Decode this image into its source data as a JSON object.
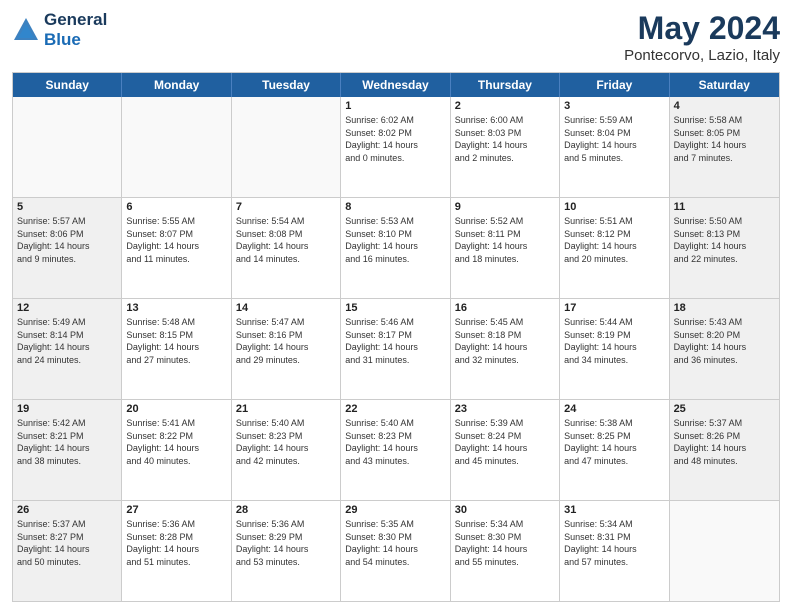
{
  "header": {
    "logo_line1": "General",
    "logo_line2": "Blue",
    "title": "May 2024",
    "subtitle": "Pontecorvo, Lazio, Italy"
  },
  "days": [
    "Sunday",
    "Monday",
    "Tuesday",
    "Wednesday",
    "Thursday",
    "Friday",
    "Saturday"
  ],
  "weeks": [
    [
      {
        "day": "",
        "empty": true
      },
      {
        "day": "",
        "empty": true
      },
      {
        "day": "",
        "empty": true
      },
      {
        "day": "1",
        "lines": [
          "Sunrise: 6:02 AM",
          "Sunset: 8:02 PM",
          "Daylight: 14 hours",
          "and 0 minutes."
        ]
      },
      {
        "day": "2",
        "lines": [
          "Sunrise: 6:00 AM",
          "Sunset: 8:03 PM",
          "Daylight: 14 hours",
          "and 2 minutes."
        ]
      },
      {
        "day": "3",
        "lines": [
          "Sunrise: 5:59 AM",
          "Sunset: 8:04 PM",
          "Daylight: 14 hours",
          "and 5 minutes."
        ]
      },
      {
        "day": "4",
        "lines": [
          "Sunrise: 5:58 AM",
          "Sunset: 8:05 PM",
          "Daylight: 14 hours",
          "and 7 minutes."
        ]
      }
    ],
    [
      {
        "day": "5",
        "lines": [
          "Sunrise: 5:57 AM",
          "Sunset: 8:06 PM",
          "Daylight: 14 hours",
          "and 9 minutes."
        ]
      },
      {
        "day": "6",
        "lines": [
          "Sunrise: 5:55 AM",
          "Sunset: 8:07 PM",
          "Daylight: 14 hours",
          "and 11 minutes."
        ]
      },
      {
        "day": "7",
        "lines": [
          "Sunrise: 5:54 AM",
          "Sunset: 8:08 PM",
          "Daylight: 14 hours",
          "and 14 minutes."
        ]
      },
      {
        "day": "8",
        "lines": [
          "Sunrise: 5:53 AM",
          "Sunset: 8:10 PM",
          "Daylight: 14 hours",
          "and 16 minutes."
        ]
      },
      {
        "day": "9",
        "lines": [
          "Sunrise: 5:52 AM",
          "Sunset: 8:11 PM",
          "Daylight: 14 hours",
          "and 18 minutes."
        ]
      },
      {
        "day": "10",
        "lines": [
          "Sunrise: 5:51 AM",
          "Sunset: 8:12 PM",
          "Daylight: 14 hours",
          "and 20 minutes."
        ]
      },
      {
        "day": "11",
        "lines": [
          "Sunrise: 5:50 AM",
          "Sunset: 8:13 PM",
          "Daylight: 14 hours",
          "and 22 minutes."
        ]
      }
    ],
    [
      {
        "day": "12",
        "lines": [
          "Sunrise: 5:49 AM",
          "Sunset: 8:14 PM",
          "Daylight: 14 hours",
          "and 24 minutes."
        ]
      },
      {
        "day": "13",
        "lines": [
          "Sunrise: 5:48 AM",
          "Sunset: 8:15 PM",
          "Daylight: 14 hours",
          "and 27 minutes."
        ]
      },
      {
        "day": "14",
        "lines": [
          "Sunrise: 5:47 AM",
          "Sunset: 8:16 PM",
          "Daylight: 14 hours",
          "and 29 minutes."
        ]
      },
      {
        "day": "15",
        "lines": [
          "Sunrise: 5:46 AM",
          "Sunset: 8:17 PM",
          "Daylight: 14 hours",
          "and 31 minutes."
        ]
      },
      {
        "day": "16",
        "lines": [
          "Sunrise: 5:45 AM",
          "Sunset: 8:18 PM",
          "Daylight: 14 hours",
          "and 32 minutes."
        ]
      },
      {
        "day": "17",
        "lines": [
          "Sunrise: 5:44 AM",
          "Sunset: 8:19 PM",
          "Daylight: 14 hours",
          "and 34 minutes."
        ]
      },
      {
        "day": "18",
        "lines": [
          "Sunrise: 5:43 AM",
          "Sunset: 8:20 PM",
          "Daylight: 14 hours",
          "and 36 minutes."
        ]
      }
    ],
    [
      {
        "day": "19",
        "lines": [
          "Sunrise: 5:42 AM",
          "Sunset: 8:21 PM",
          "Daylight: 14 hours",
          "and 38 minutes."
        ]
      },
      {
        "day": "20",
        "lines": [
          "Sunrise: 5:41 AM",
          "Sunset: 8:22 PM",
          "Daylight: 14 hours",
          "and 40 minutes."
        ]
      },
      {
        "day": "21",
        "lines": [
          "Sunrise: 5:40 AM",
          "Sunset: 8:23 PM",
          "Daylight: 14 hours",
          "and 42 minutes."
        ]
      },
      {
        "day": "22",
        "lines": [
          "Sunrise: 5:40 AM",
          "Sunset: 8:23 PM",
          "Daylight: 14 hours",
          "and 43 minutes."
        ]
      },
      {
        "day": "23",
        "lines": [
          "Sunrise: 5:39 AM",
          "Sunset: 8:24 PM",
          "Daylight: 14 hours",
          "and 45 minutes."
        ]
      },
      {
        "day": "24",
        "lines": [
          "Sunrise: 5:38 AM",
          "Sunset: 8:25 PM",
          "Daylight: 14 hours",
          "and 47 minutes."
        ]
      },
      {
        "day": "25",
        "lines": [
          "Sunrise: 5:37 AM",
          "Sunset: 8:26 PM",
          "Daylight: 14 hours",
          "and 48 minutes."
        ]
      }
    ],
    [
      {
        "day": "26",
        "lines": [
          "Sunrise: 5:37 AM",
          "Sunset: 8:27 PM",
          "Daylight: 14 hours",
          "and 50 minutes."
        ]
      },
      {
        "day": "27",
        "lines": [
          "Sunrise: 5:36 AM",
          "Sunset: 8:28 PM",
          "Daylight: 14 hours",
          "and 51 minutes."
        ]
      },
      {
        "day": "28",
        "lines": [
          "Sunrise: 5:36 AM",
          "Sunset: 8:29 PM",
          "Daylight: 14 hours",
          "and 53 minutes."
        ]
      },
      {
        "day": "29",
        "lines": [
          "Sunrise: 5:35 AM",
          "Sunset: 8:30 PM",
          "Daylight: 14 hours",
          "and 54 minutes."
        ]
      },
      {
        "day": "30",
        "lines": [
          "Sunrise: 5:34 AM",
          "Sunset: 8:30 PM",
          "Daylight: 14 hours",
          "and 55 minutes."
        ]
      },
      {
        "day": "31",
        "lines": [
          "Sunrise: 5:34 AM",
          "Sunset: 8:31 PM",
          "Daylight: 14 hours",
          "and 57 minutes."
        ]
      },
      {
        "day": "",
        "empty": true
      }
    ]
  ]
}
